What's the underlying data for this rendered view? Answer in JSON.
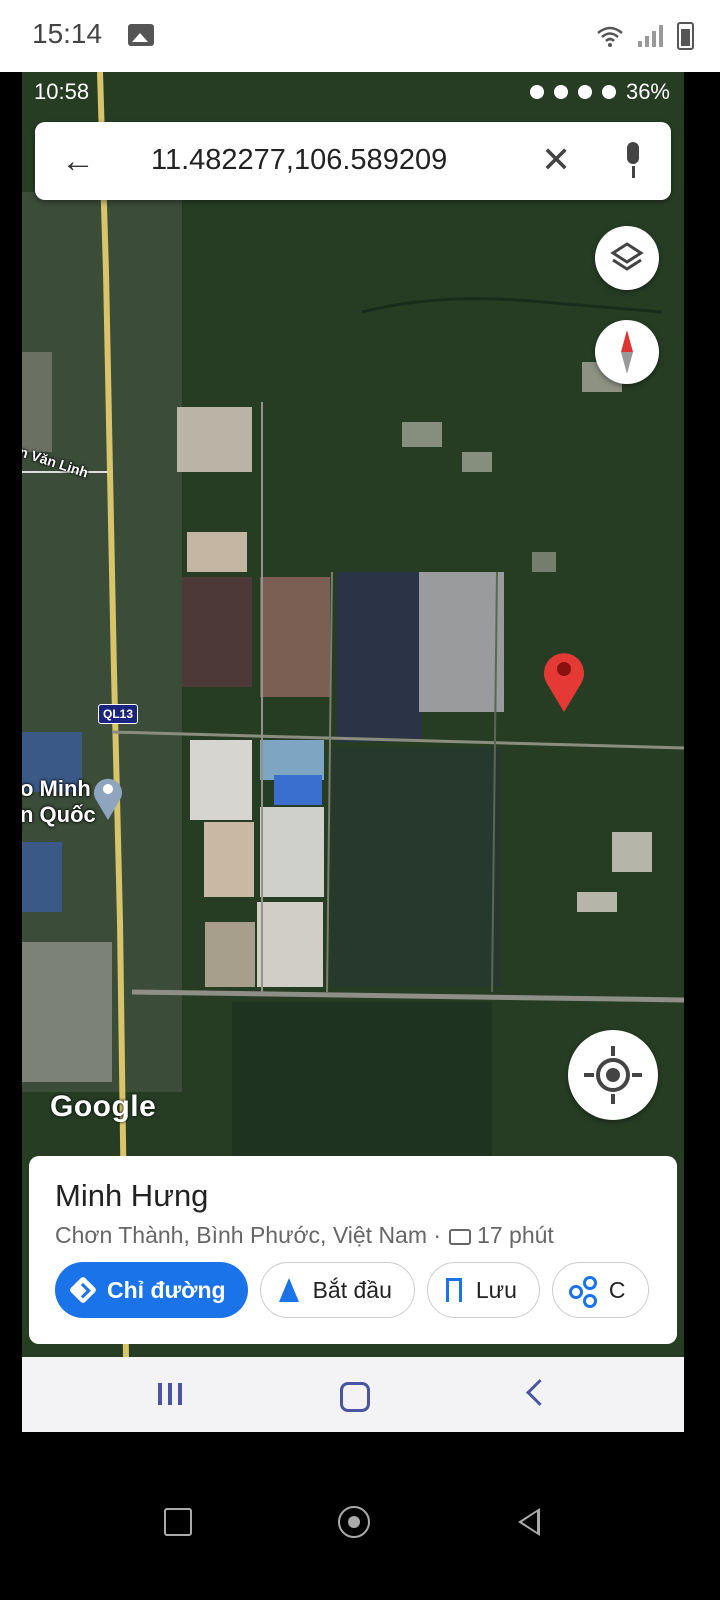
{
  "device": {
    "status_time": "15:14",
    "status_icons": [
      "gallery-icon",
      "wifi-icon",
      "signal-icon",
      "battery-icon"
    ]
  },
  "screenshot": {
    "status": {
      "time": "10:58",
      "app_icons": [
        "zalo-icon",
        "gallery-icon",
        "download-icon"
      ],
      "system_icons": [
        "alarm-icon",
        "bluetooth-icon",
        "location-icon",
        "wifi-icon",
        "signal-icon",
        "signal-icon"
      ],
      "battery": "36%"
    },
    "search": {
      "query": "11.482277,106.589209",
      "back_icon": "arrow-back-icon",
      "clear_icon": "close-icon",
      "mic_icon": "mic-icon"
    },
    "map": {
      "road_label": "QL13",
      "street_label": "n Văn Linh",
      "poi_label_line1": "o Minh",
      "poi_label_line2": "n Quốc",
      "attribution": "Google",
      "marker": "red-pin-icon"
    },
    "place_card": {
      "name": "Minh Hưng",
      "address": "Chơn Thành, Bình Phước, Việt Nam ·",
      "travel_time": "17 phút",
      "actions": [
        {
          "label": "Chỉ đường",
          "icon": "directions-icon"
        },
        {
          "label": "Bắt đầu",
          "icon": "navigation-arrow-icon"
        },
        {
          "label": "Lưu",
          "icon": "bookmark-icon"
        },
        {
          "label": "C",
          "icon": "share-icon"
        }
      ]
    },
    "colors": {
      "primary": "#1a73e8",
      "marker": "#e53935",
      "nav": "#4a55a2"
    }
  }
}
